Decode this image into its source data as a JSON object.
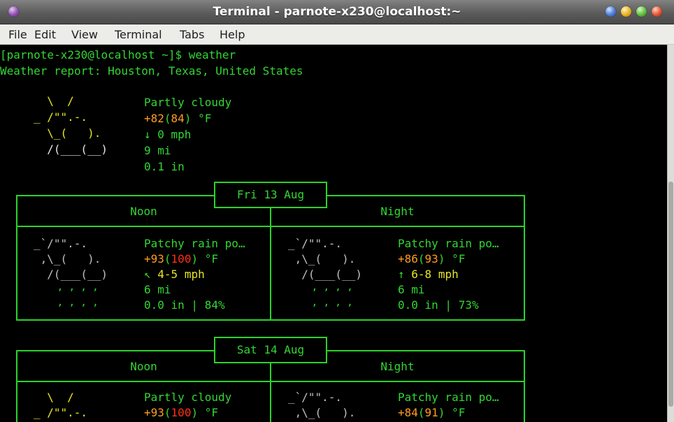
{
  "window": {
    "title": "Terminal - parnote-x230@localhost:~"
  },
  "menu": [
    "File",
    "Edit",
    "View",
    "Terminal",
    "Tabs",
    "Help"
  ],
  "prompt": {
    "text": "[parnote-x230@localhost ~]$ ",
    "command": "weather"
  },
  "report_header": "Weather report: Houston, Texas, United States",
  "current": {
    "art": [
      "  \\  /",
      "_ /\"\".-.",
      "  \\_(   ).",
      "  /(___(__)"
    ],
    "condition": "Partly cloudy",
    "temp": "+82",
    "feels": "84",
    "unit": " °F",
    "wind_arrow": "↓",
    "wind": " 0 mph",
    "visibility": "9 mi",
    "precip": "0.1 in"
  },
  "days": [
    {
      "date": "Fri 13 Aug",
      "periods": [
        {
          "name": "Noon",
          "art": [
            "_`/\"\".-.",
            " ,\\_(   ).",
            "  /(___(__)",
            "    ‚ ‚ ‚ ‚",
            "    ‚ ‚ ‚ ‚"
          ],
          "condition": "Patchy rain po…",
          "temp": "+93",
          "feels": "100",
          "unit": " °F",
          "wind_arrow": "↖",
          "wind": "4-5 mph",
          "visibility": "6 mi",
          "precip": "0.0 in | 84%"
        },
        {
          "name": "Night",
          "art": [
            "_`/\"\".-.",
            " ,\\_(   ).",
            "  /(___(__)",
            "    ‚ ‚ ‚ ‚",
            "    ‚ ‚ ‚ ‚"
          ],
          "condition": "Patchy rain po…",
          "temp": "+86",
          "feels": "93",
          "unit": " °F",
          "wind_arrow": "↑",
          "wind": "6-8 mph",
          "visibility": "6 mi",
          "precip": "0.0 in | 73%"
        }
      ]
    },
    {
      "date": "Sat 14 Aug",
      "periods": [
        {
          "name": "Noon",
          "art": [
            "  \\  /",
            "_ /\"\".-."
          ],
          "condition": "Partly cloudy",
          "temp": "+93",
          "feels": "100",
          "unit": " °F"
        },
        {
          "name": "Night",
          "art": [
            "_`/\"\".-.",
            " ,\\_(   )."
          ],
          "condition": "Patchy rain po…",
          "temp": "+84",
          "feels": "91",
          "unit": " °F"
        }
      ]
    }
  ]
}
